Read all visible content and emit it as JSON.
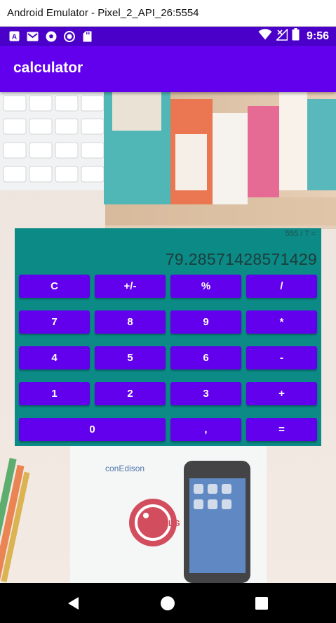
{
  "window": {
    "title": "Android Emulator - Pixel_2_API_26:5554"
  },
  "status_bar": {
    "time": "9:56",
    "notification_icons": [
      "keyboard-icon",
      "gmail-icon",
      "soccer-ball-icon",
      "circle-icon",
      "sd-card-icon"
    ],
    "system_icons": [
      "wifi-icon",
      "no-signal-icon",
      "battery-icon"
    ]
  },
  "app_bar": {
    "title": "calculator"
  },
  "calculator": {
    "expression": "555 / 7 =",
    "result": "79.28571428571429",
    "keys": {
      "clear": "C",
      "sign": "+/-",
      "percent": "%",
      "divide": "/",
      "seven": "7",
      "eight": "8",
      "nine": "9",
      "multiply": "*",
      "four": "4",
      "five": "5",
      "six": "6",
      "subtract": "-",
      "one": "1",
      "two": "2",
      "three": "3",
      "add": "+",
      "zero": "0",
      "decimal": ",",
      "equals": "="
    }
  },
  "background": {
    "logos": {
      "brand": "conEdison",
      "lg": "LG"
    }
  },
  "colors": {
    "status_bar": "#4a00c9",
    "app_bar": "#6200ee",
    "calc_panel": "#0b8a86",
    "key": "#6200ee"
  }
}
